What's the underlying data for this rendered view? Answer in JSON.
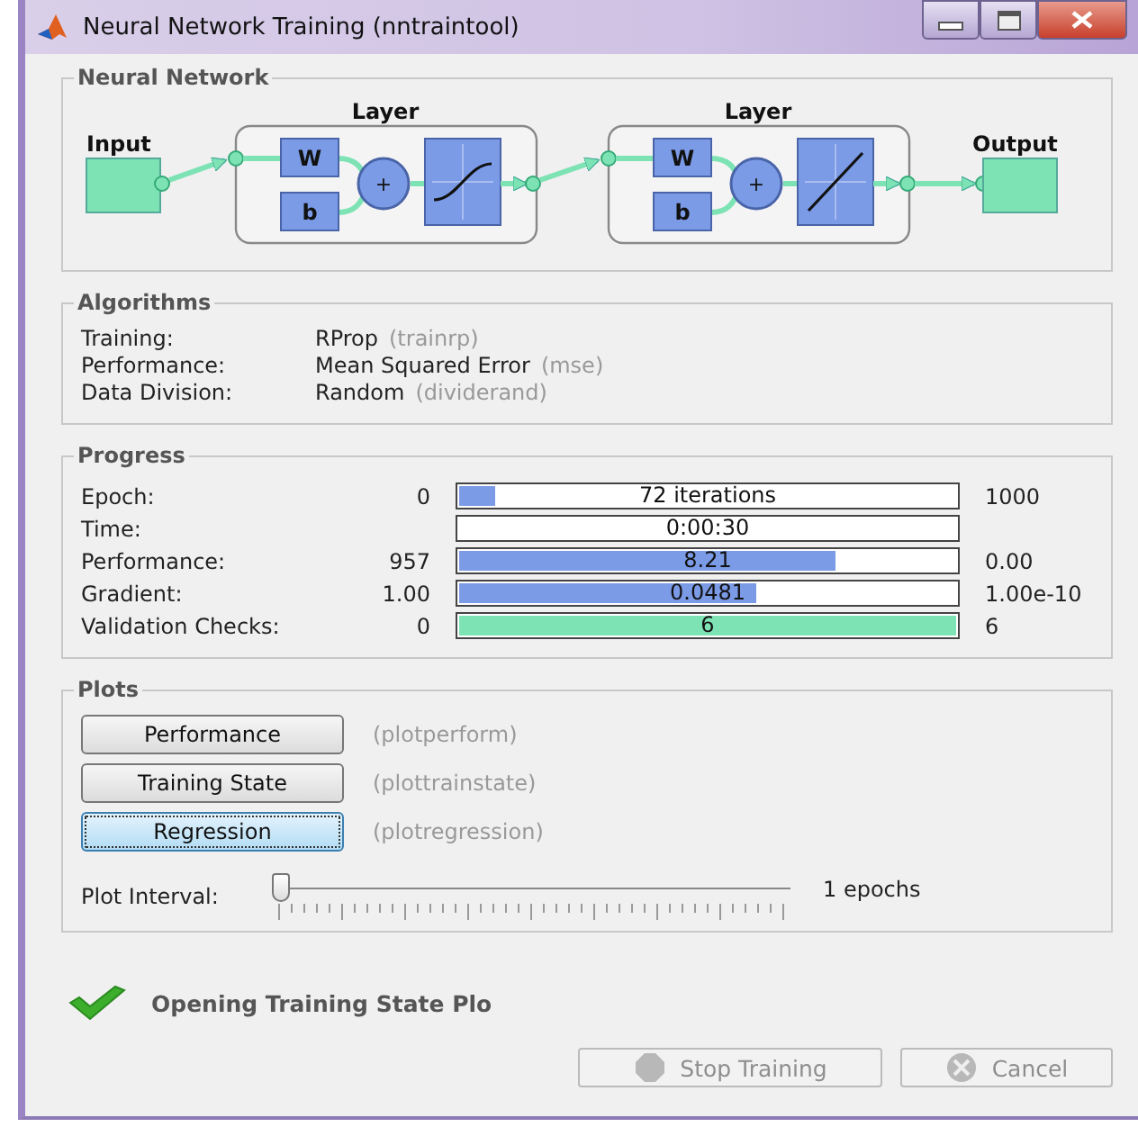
{
  "window": {
    "title": "Neural Network Training (nntraintool)"
  },
  "network": {
    "title": "Neural Network",
    "input_label": "Input",
    "output_label": "Output",
    "layers": [
      {
        "title": "Layer",
        "weight": "W",
        "bias": "b",
        "sum": "+",
        "kind": "sigmoid"
      },
      {
        "title": "Layer",
        "weight": "W",
        "bias": "b",
        "sum": "+",
        "kind": "linear"
      }
    ]
  },
  "algorithms": {
    "title": "Algorithms",
    "rows": [
      {
        "label": "Training:",
        "value": "RProp",
        "function": "(trainrp)"
      },
      {
        "label": "Performance:",
        "value": "Mean Squared Error",
        "function": "(mse)"
      },
      {
        "label": "Data Division:",
        "value": "Random",
        "function": "(dividerand)"
      }
    ]
  },
  "progress": {
    "title": "Progress",
    "rows": [
      {
        "label": "Epoch:",
        "start": "0",
        "bar_text": "72 iterations",
        "level": 0.072,
        "color": "#7b9be6",
        "end": "1000"
      },
      {
        "label": "Time:",
        "bar_text": "0:00:30"
      },
      {
        "label": "Performance:",
        "start": "957",
        "bar_text": "8.21",
        "level": 0.75,
        "color": "#7b9be6",
        "end": "0.00"
      },
      {
        "label": "Gradient:",
        "start": "1.00",
        "bar_text": "0.0481",
        "level": 0.595,
        "color": "#7b9be6",
        "end": "1.00e-10"
      },
      {
        "label": "Validation Checks:",
        "start": "0",
        "bar_text": "6",
        "level": 1,
        "color": "#7ee3b4",
        "end": "6"
      }
    ]
  },
  "plots": {
    "title": "Plots",
    "buttons": [
      {
        "label": "Performance",
        "function": "(plotperform)",
        "focused": false
      },
      {
        "label": "Training State",
        "function": "(plottrainstate)",
        "focused": false
      },
      {
        "label": "Regression",
        "function": "(plotregression)",
        "focused": true
      }
    ],
    "interval": {
      "label": "Plot Interval:",
      "level": 0,
      "reading": "1 epochs"
    }
  },
  "status": {
    "text": "Opening Training State Plo",
    "ok": true
  },
  "buttons": [
    {
      "label": "Stop Training",
      "kind": "stop",
      "disabled": true
    },
    {
      "label": "Cancel",
      "kind": "cancel",
      "disabled": true
    }
  ]
}
